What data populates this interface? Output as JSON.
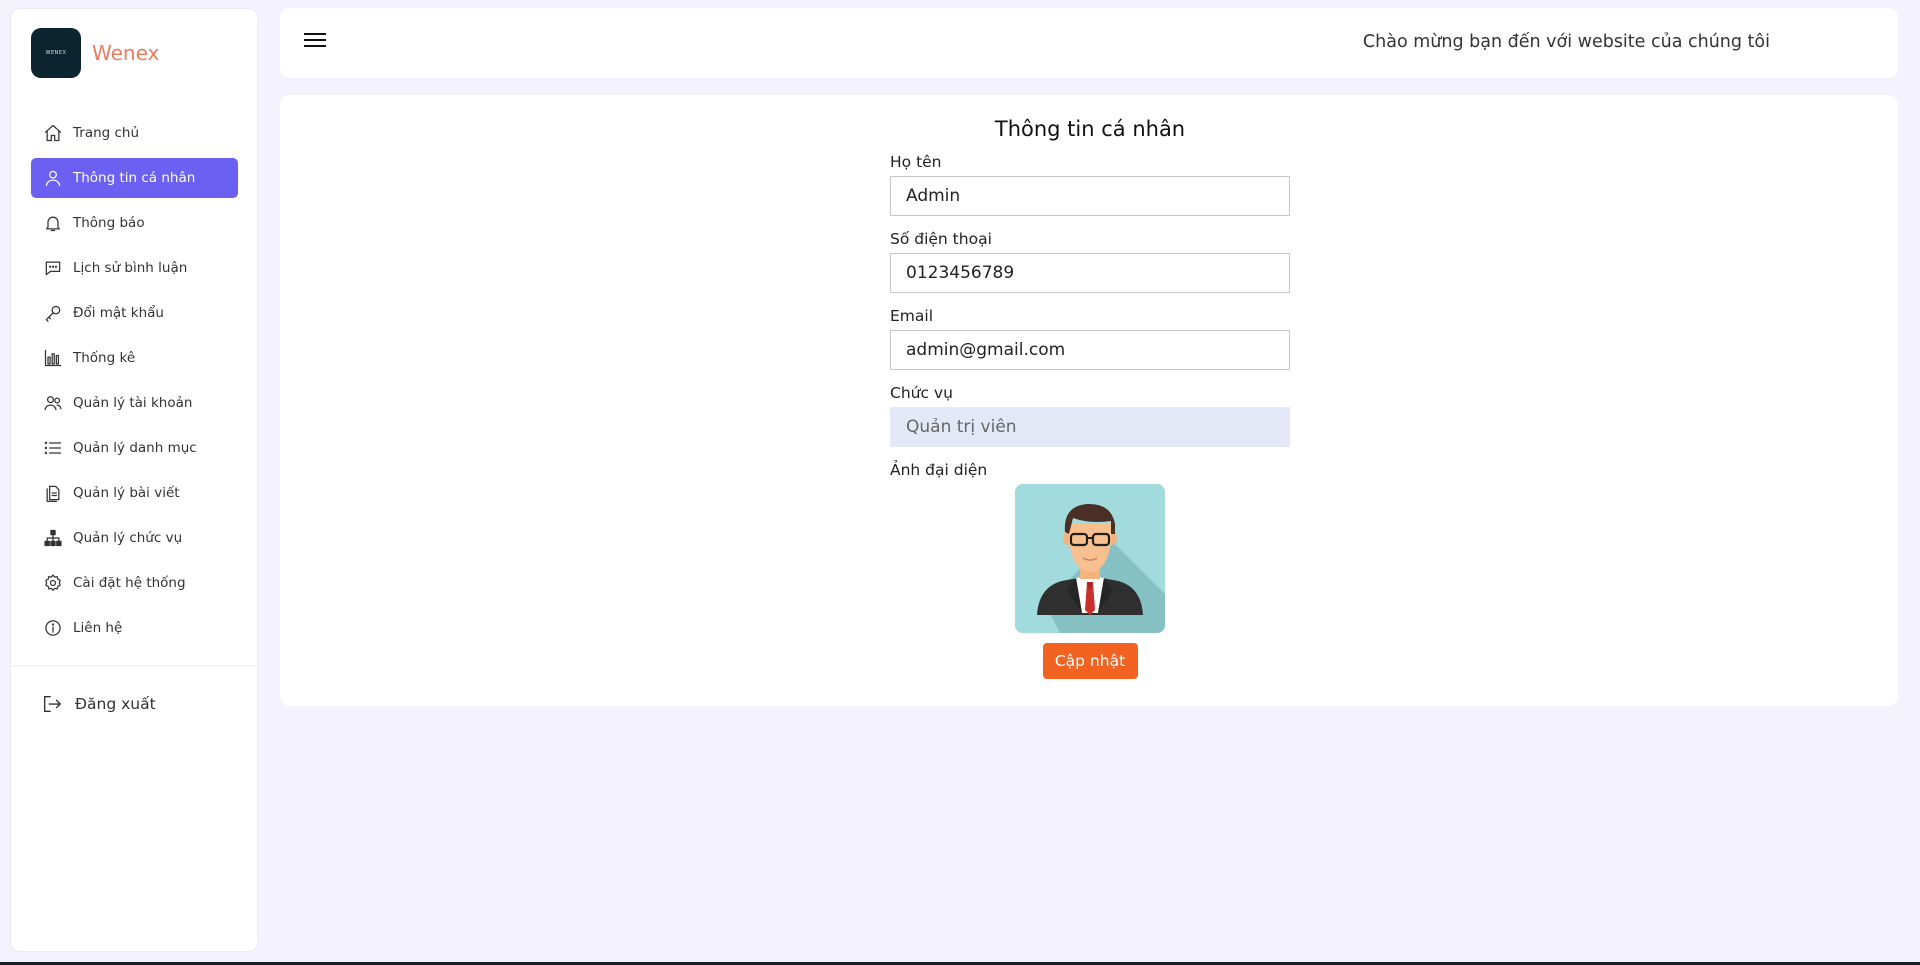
{
  "brand": {
    "logo_text": "WENEX",
    "name": "Wenex"
  },
  "sidebar": {
    "items": [
      {
        "label": "Trang chủ",
        "icon": "home-icon"
      },
      {
        "label": "Thông tin cá nhân",
        "icon": "user-icon"
      },
      {
        "label": "Thông báo",
        "icon": "bell-icon"
      },
      {
        "label": "Lịch sử bình luận",
        "icon": "comment-icon"
      },
      {
        "label": "Đổi mật khẩu",
        "icon": "key-icon"
      },
      {
        "label": "Thống kê",
        "icon": "bar-chart-icon"
      },
      {
        "label": "Quản lý tài khoản",
        "icon": "users-icon"
      },
      {
        "label": "Quản lý danh mục",
        "icon": "list-icon"
      },
      {
        "label": "Quản lý bài viết",
        "icon": "documents-icon"
      },
      {
        "label": "Quản lý chức vụ",
        "icon": "sitemap-icon"
      },
      {
        "label": "Cài đặt hệ thống",
        "icon": "gear-icon"
      },
      {
        "label": "Liên hệ",
        "icon": "info-icon"
      }
    ],
    "active_index": 1,
    "logout_label": "Đăng xuất"
  },
  "header": {
    "welcome": "Chào mừng bạn đến với website của chúng tôi"
  },
  "form": {
    "title": "Thông tin cá nhân",
    "name_label": "Họ tên",
    "name_value": "Admin",
    "phone_label": "Số điện thoại",
    "phone_value": "0123456789",
    "email_label": "Email",
    "email_value": "admin@gmail.com",
    "role_label": "Chức vụ",
    "role_value": "Quản trị viên",
    "avatar_label": "Ảnh đại diện",
    "submit_label": "Cập nhật"
  },
  "colors": {
    "accent": "#6b60f2",
    "button": "#f26322",
    "brand": "#ee7b5d"
  }
}
